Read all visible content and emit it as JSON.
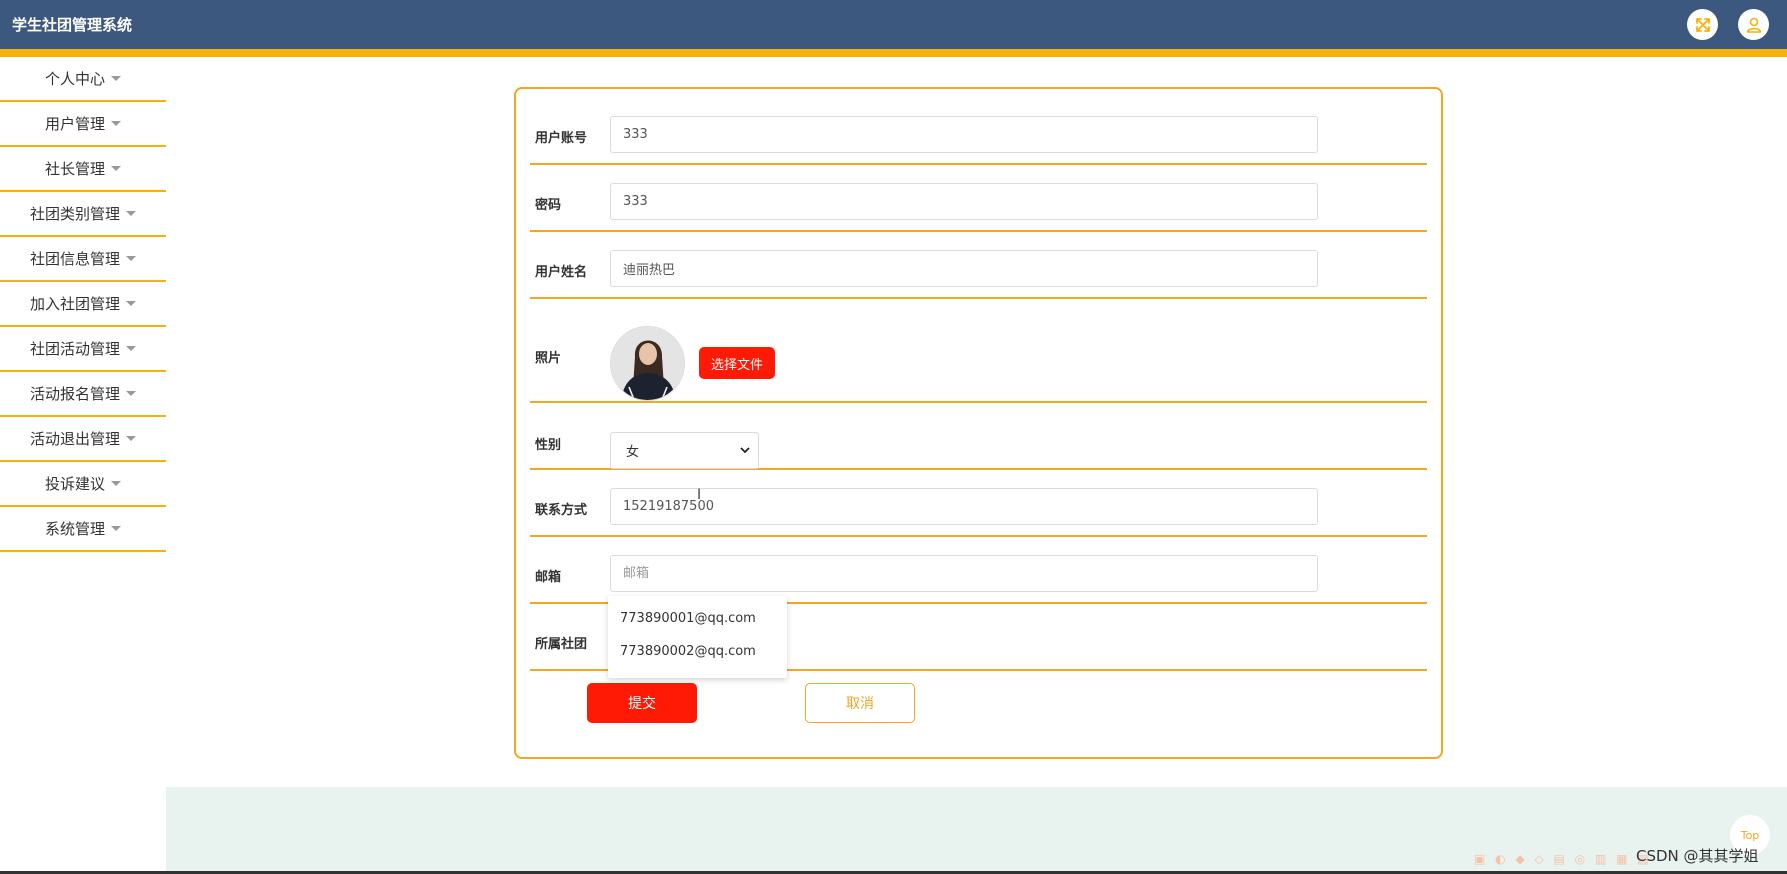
{
  "header": {
    "title": "学生社团管理系统",
    "fullscreen_icon": "fullscreen-arrows-icon",
    "user_icon": "user-icon",
    "colors": {
      "bar": "#3d587f",
      "stripe": "#f5b20c"
    }
  },
  "sidebar": {
    "items": [
      {
        "label": "个人中心"
      },
      {
        "label": "用户管理"
      },
      {
        "label": "社长管理"
      },
      {
        "label": "社团类别管理"
      },
      {
        "label": "社团信息管理"
      },
      {
        "label": "加入社团管理"
      },
      {
        "label": "社团活动管理"
      },
      {
        "label": "活动报名管理"
      },
      {
        "label": "活动退出管理"
      },
      {
        "label": "投诉建议"
      },
      {
        "label": "系统管理"
      }
    ]
  },
  "form": {
    "account": {
      "label": "用户账号",
      "value": "333"
    },
    "password": {
      "label": "密码",
      "value": "333"
    },
    "name": {
      "label": "用户姓名",
      "value": "迪丽热巴"
    },
    "photo": {
      "label": "照片",
      "button": "选择文件"
    },
    "gender": {
      "label": "性别",
      "value": "女"
    },
    "phone": {
      "label": "联系方式",
      "value": "15219187500"
    },
    "email": {
      "label": "邮箱",
      "placeholder": "邮箱",
      "suggestions": [
        "773890001@qq.com",
        "773890002@qq.com"
      ]
    },
    "club": {
      "label": "所属社团"
    },
    "submit_label": "提交",
    "cancel_label": "取消",
    "colors": {
      "accent": "#f5a623",
      "primary_button": "#ff1a05"
    }
  },
  "footer": {
    "top_label": "Top",
    "watermark": "CSDN @其其学姐"
  }
}
